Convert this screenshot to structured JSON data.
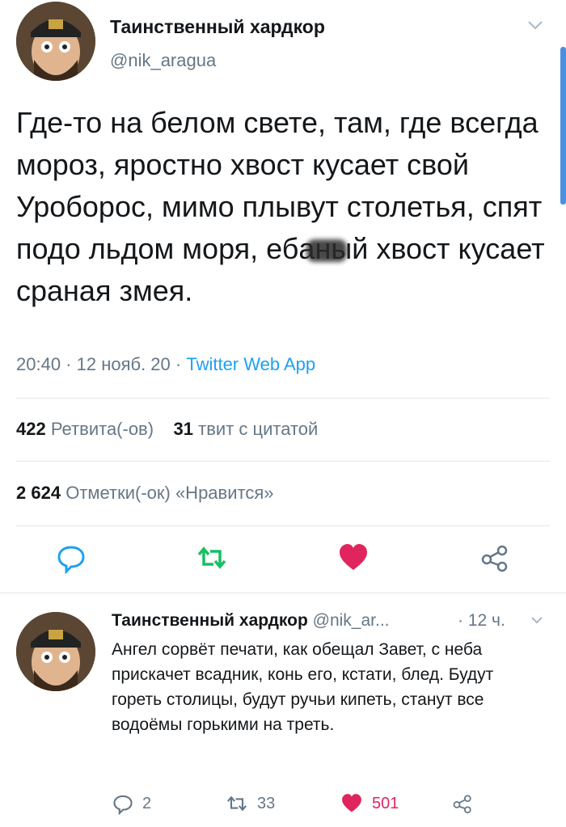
{
  "main_tweet": {
    "author": {
      "name": "Таинственный хардкор",
      "handle": "@nik_aragua"
    },
    "text_before": "Где-то на белом свете, там, где всегда мороз, яростно хвост кусает свой Уроборос, мимо плывут столетья, спят подо льдом моря, еб",
    "text_censored": "аны",
    "text_after": "й хвост кусает сраная змея.",
    "time": "20:40 · 12 нояб. 20 · ",
    "source": "Twitter Web App",
    "retweets": {
      "count": "422",
      "label": "Ретвита(-ов)"
    },
    "quotes": {
      "count": "31",
      "label": "твит с цитатой"
    },
    "likes": {
      "count": "2 624",
      "label": "Отметки(-ок) «Нравится»"
    },
    "icons": [
      "chat-bubble-icon",
      "retweet-icon",
      "heart-icon",
      "share-icon"
    ],
    "colors": {
      "retweet": "#17bf63",
      "like": "#e0245e",
      "link": "#1da1f2",
      "muted": "#657786"
    }
  },
  "reply_tweet": {
    "author": {
      "name": "Таинственный хардкор",
      "handle": "@nik_ar...",
      "time": "· 12 ч."
    },
    "text": "Ангел сорвёт печати, как обещал Завет, с неба прискачет всадник, конь его, кстати, блед. Будут гореть столицы, будут ручьи кипеть, станут все водоёмы горькими на треть.",
    "replies": "2",
    "retweets": "33",
    "likes": "501"
  }
}
